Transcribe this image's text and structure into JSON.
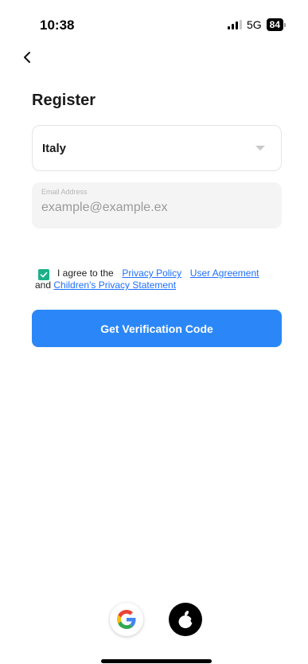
{
  "status_bar": {
    "time": "10:38",
    "network": "5G",
    "battery": "84"
  },
  "page": {
    "title": "Register"
  },
  "country": {
    "value": "Italy"
  },
  "email": {
    "label": "Email Address",
    "placeholder": "example@example.ex"
  },
  "agreement": {
    "checked": true,
    "prefix": "I agree to the",
    "privacy_policy": "Privacy Policy",
    "user_agreement": "User Agreement",
    "conjunction": "and",
    "childrens_privacy": "Children's Privacy Statement"
  },
  "actions": {
    "get_code_label": "Get Verification Code"
  },
  "social_login": [
    "google-icon",
    "apple-icon"
  ],
  "colors": {
    "primary_button": "#2b87f7",
    "checkbox": "#1bb18a",
    "link": "#1f6fff"
  }
}
